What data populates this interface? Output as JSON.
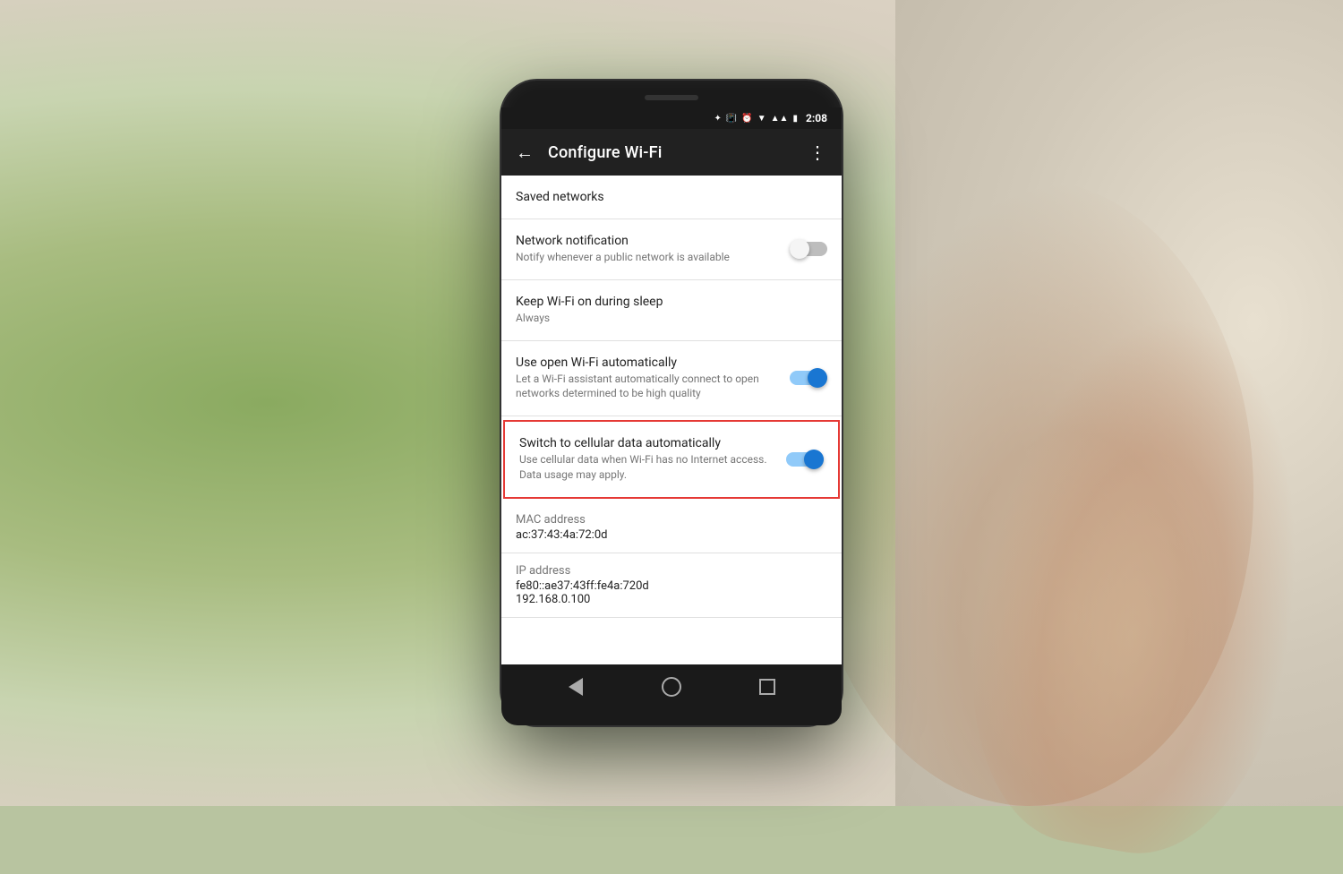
{
  "background": {
    "color_left": "#8aaa60",
    "color_right": "#d0c8b8"
  },
  "phone": {
    "status_bar": {
      "time": "2:08",
      "icons": [
        "bluetooth",
        "vibrate",
        "alarm",
        "wifi",
        "signal",
        "battery"
      ]
    },
    "app_bar": {
      "title": "Configure Wi-Fi",
      "back_icon": "←",
      "menu_icon": "⋮"
    },
    "settings": {
      "items": [
        {
          "id": "saved-networks",
          "title": "Saved networks",
          "subtitle": "",
          "has_toggle": false,
          "toggle_state": null,
          "is_link": true,
          "highlighted": false
        },
        {
          "id": "network-notification",
          "title": "Network notification",
          "subtitle": "Notify whenever a public network is available",
          "has_toggle": true,
          "toggle_state": "off",
          "is_link": false,
          "highlighted": false
        },
        {
          "id": "keep-wifi-sleep",
          "title": "Keep Wi-Fi on during sleep",
          "subtitle": "Always",
          "has_toggle": false,
          "toggle_state": null,
          "is_link": false,
          "highlighted": false
        },
        {
          "id": "use-open-wifi",
          "title": "Use open Wi-Fi automatically",
          "subtitle": "Let a Wi-Fi assistant automatically connect to open networks determined to be high quality",
          "has_toggle": true,
          "toggle_state": "on",
          "is_link": false,
          "highlighted": false
        },
        {
          "id": "switch-cellular",
          "title": "Switch to cellular data automatically",
          "subtitle": "Use cellular data when Wi-Fi has no Internet access. Data usage may apply.",
          "has_toggle": true,
          "toggle_state": "on",
          "is_link": false,
          "highlighted": true
        }
      ],
      "info_items": [
        {
          "id": "mac-address",
          "label": "MAC address",
          "value": "ac:37:43:4a:72:0d"
        },
        {
          "id": "ip-address",
          "label": "IP address",
          "value1": "fe80::ae37:43ff:fe4a:720d",
          "value2": "192.168.0.100"
        }
      ]
    },
    "nav_bar": {
      "back_label": "back",
      "home_label": "home",
      "recents_label": "recents"
    }
  }
}
